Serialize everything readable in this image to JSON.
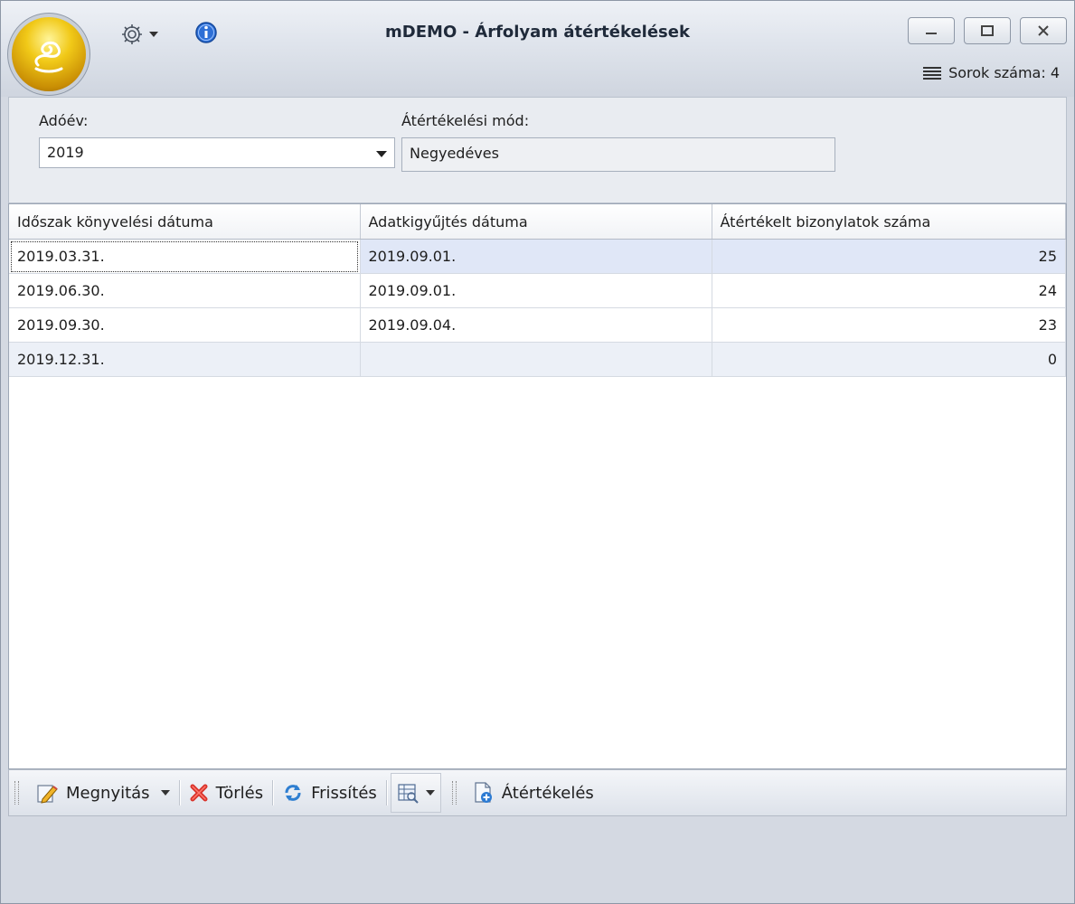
{
  "window": {
    "title": "mDEMO - Árfolyam átértékelések",
    "row_count_label": "Sorok száma: 4"
  },
  "filter": {
    "year_label": "Adóév:",
    "year_value": "2019",
    "mode_label": "Átértékelési mód:",
    "mode_value": "Negyedéves"
  },
  "grid": {
    "columns": [
      "Időszak könyvelési dátuma",
      "Adatkigyűjtés dátuma",
      "Átértékelt bizonylatok száma"
    ],
    "rows": [
      [
        "2019.03.31.",
        "2019.09.01.",
        "25"
      ],
      [
        "2019.06.30.",
        "2019.09.01.",
        "24"
      ],
      [
        "2019.09.30.",
        "2019.09.04.",
        "23"
      ],
      [
        "2019.12.31.",
        "",
        "0"
      ]
    ]
  },
  "toolbar": {
    "open_label": "Megnyitás",
    "delete_label": "Törlés",
    "refresh_label": "Frissítés",
    "revalue_label": "Átértékelés"
  },
  "icons": {
    "orb": "app-orb-icon",
    "settings": "gear-icon",
    "info": "info-icon",
    "open": "pencil-icon",
    "delete": "red-x-icon",
    "refresh": "refresh-icon",
    "view": "grid-view-icon",
    "revalue": "document-add-icon"
  },
  "colors": {
    "orb": "#f1c918",
    "selection": "#e0e7f7",
    "alt_row": "#ecf0f7"
  }
}
